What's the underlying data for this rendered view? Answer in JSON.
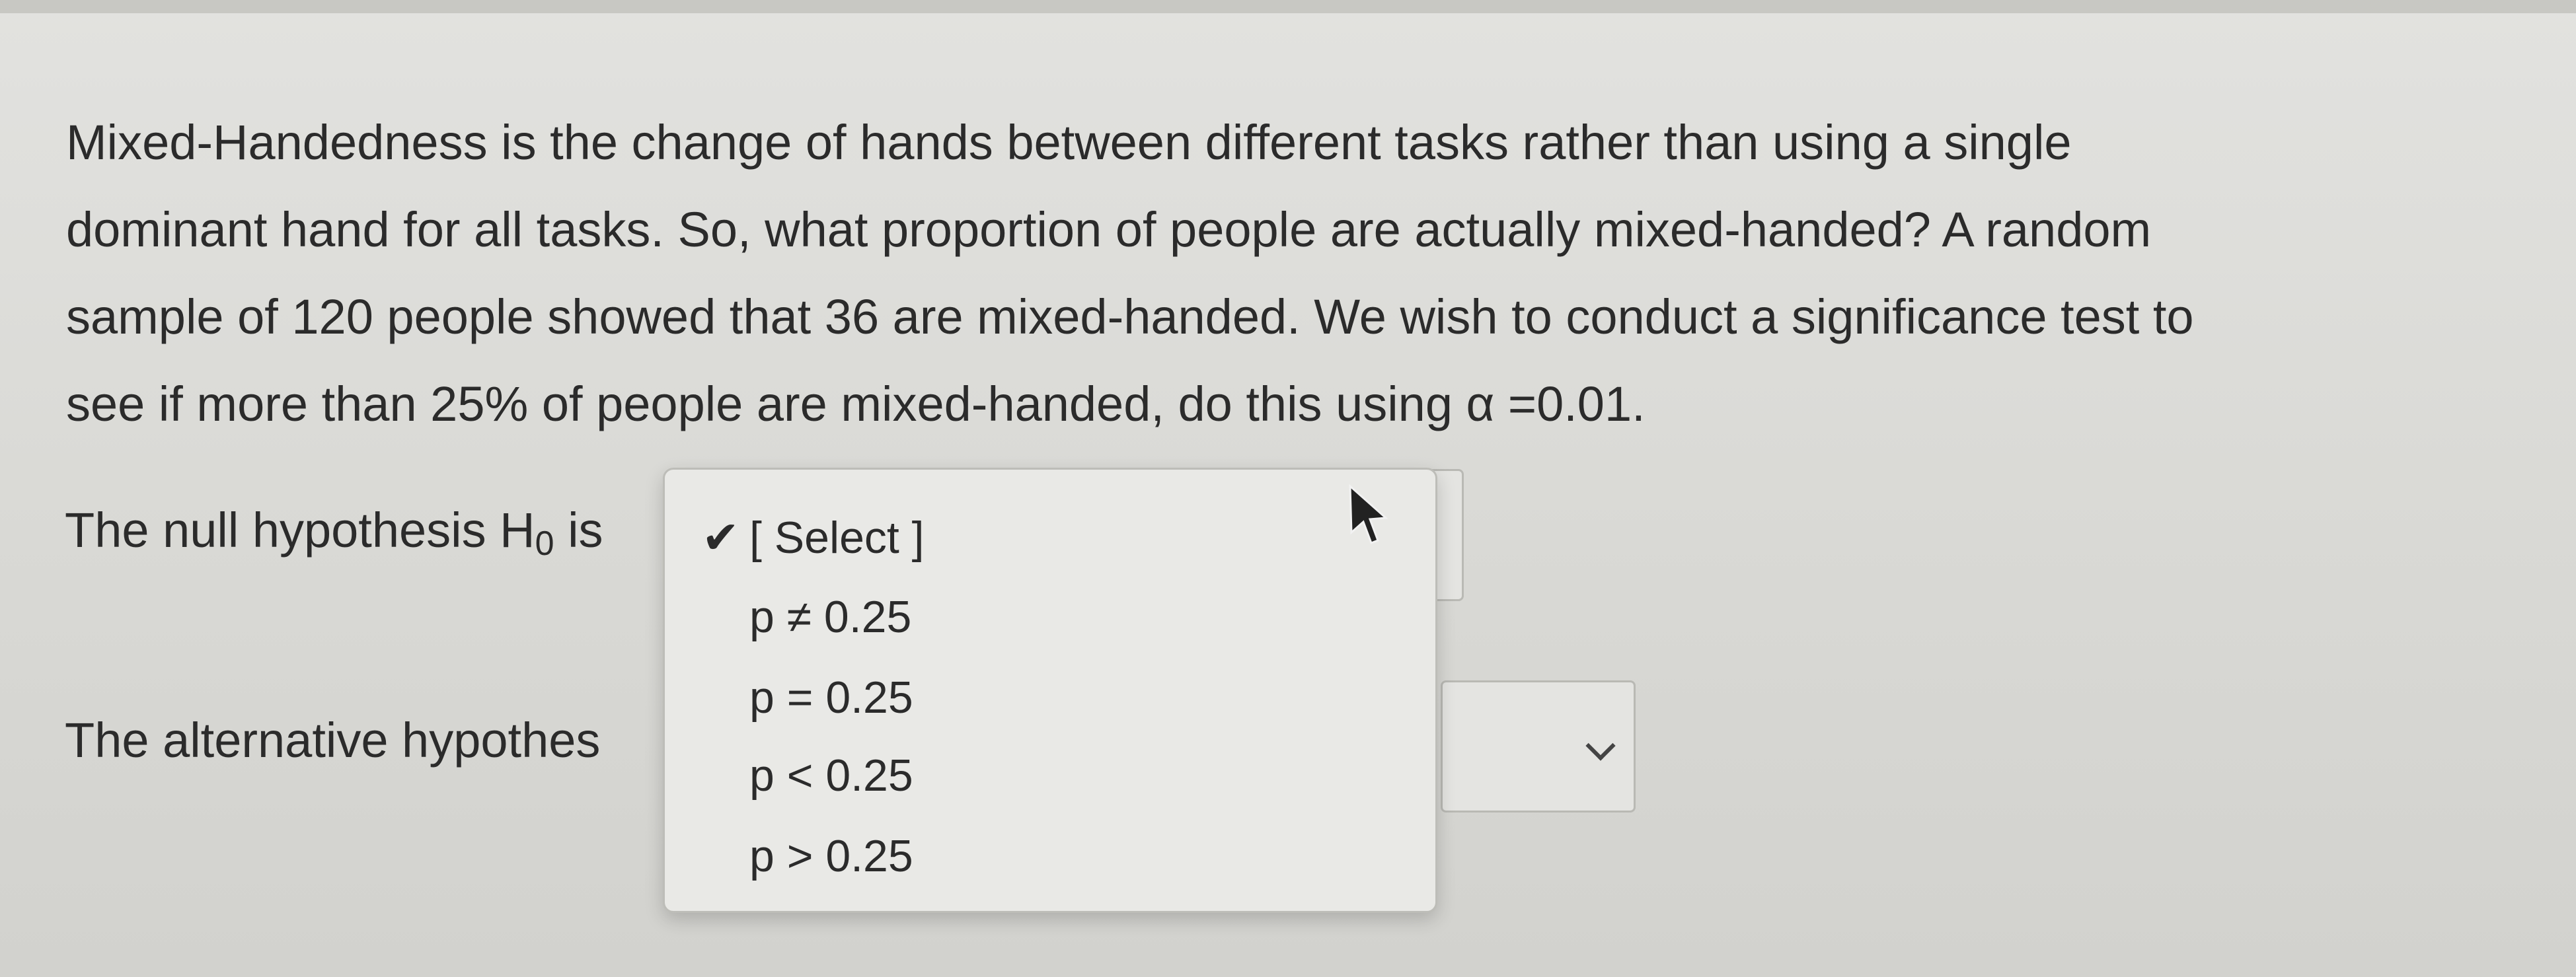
{
  "question": {
    "lines": [
      "Mixed-Handedness is the change of hands between different tasks rather than using a single",
      "dominant hand for all tasks. So, what proportion of people are actually mixed-handed? A random",
      "sample of 120 people showed that 36 are mixed-handed. We wish to conduct a significance test to",
      "see if more than 25% of people are mixed-handed, do this using α =0.01."
    ]
  },
  "null_hypothesis": {
    "label_prefix": "The null hypothesis H",
    "label_sub": "0",
    "label_suffix": " is"
  },
  "alternative_hypothesis": {
    "label": "The alternative hypothes"
  },
  "dropdown": {
    "options": [
      {
        "label": "[ Select ]",
        "checked": "✔"
      },
      {
        "label": "p ≠ 0.25",
        "checked": ""
      },
      {
        "label": "p = 0.25",
        "checked": ""
      },
      {
        "label": "p < 0.25",
        "checked": ""
      },
      {
        "label": "p > 0.25",
        "checked": ""
      }
    ]
  },
  "icons": {
    "checkmark": "checkmark-icon",
    "chevron": "chevron-down-icon",
    "cursor": "mouse-pointer-icon"
  }
}
